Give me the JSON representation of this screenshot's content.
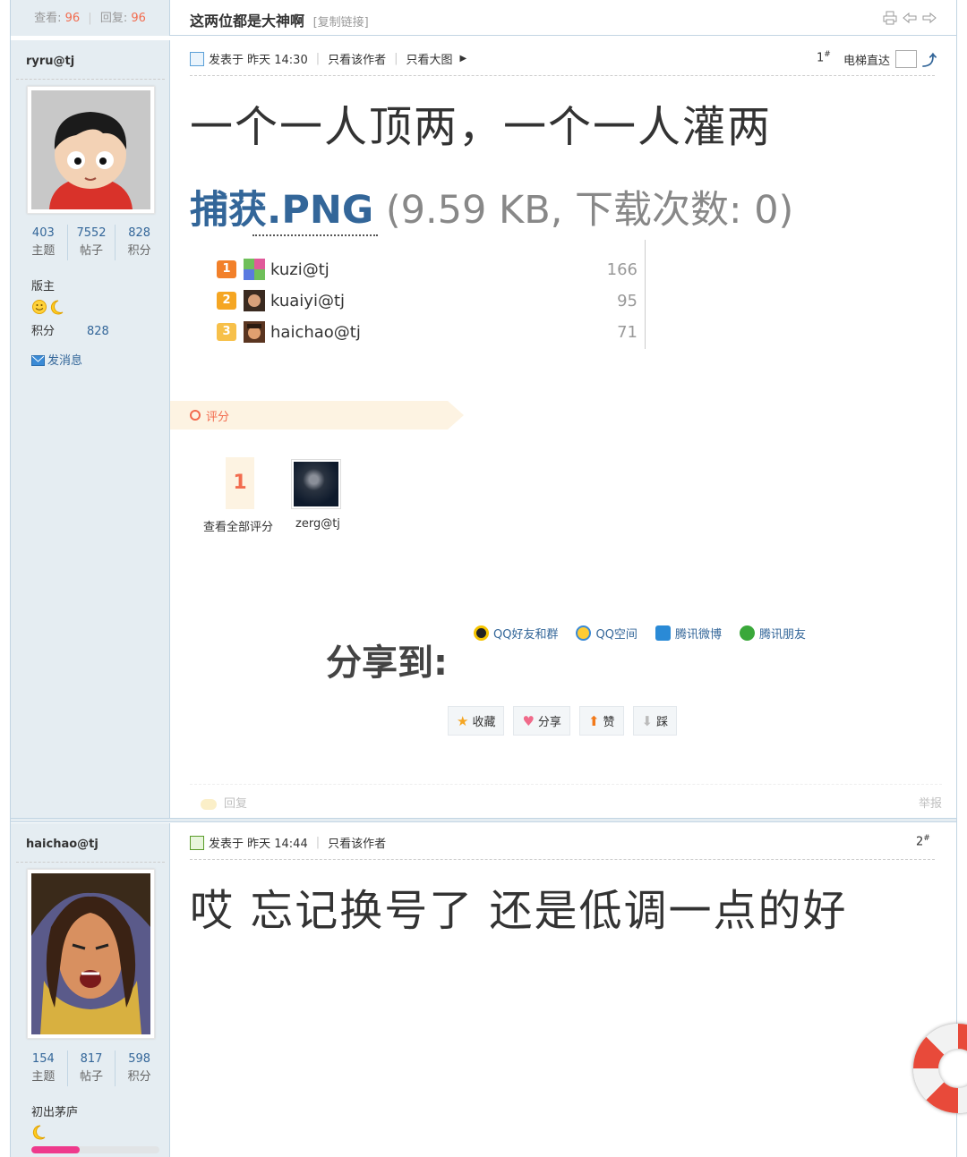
{
  "thread": {
    "views_label": "查看:",
    "views": "96",
    "replies_label": "回复:",
    "replies": "96",
    "title": "这两位都是大神啊",
    "copy_link": "[复制链接]"
  },
  "post1": {
    "author": "ryru@tj",
    "stats": [
      {
        "value": "403",
        "label": "主题"
      },
      {
        "value": "7552",
        "label": "帖子"
      },
      {
        "value": "828",
        "label": "积分"
      }
    ],
    "rank": "版主",
    "points_label": "积分",
    "points": "828",
    "send_message": "发消息",
    "posted": "发表于 昨天 14:30",
    "only_author": "只看该作者",
    "only_big_img": "只看大图",
    "floor": "1",
    "elevator": "电梯直达",
    "content": "一个一人顶两，一个一人灌两",
    "attachment_name": "捕获.PNG",
    "attachment_meta": "(9.59 KB, 下载次数: 0)",
    "ranking": [
      {
        "pos": "1",
        "name": "kuzi@tj",
        "score": "166",
        "color": "#f2802a"
      },
      {
        "pos": "2",
        "name": "kuaiyi@tj",
        "score": "95",
        "color": "#f5a623"
      },
      {
        "pos": "3",
        "name": "haichao@tj",
        "score": "71",
        "color": "#f7c04a"
      }
    ],
    "rating_label": "评分",
    "rating_count": "1",
    "rating_view_all": "查看全部评分",
    "rater": "zerg@tj",
    "share_title": "分享到:",
    "share_links": [
      "QQ好友和群",
      "QQ空间",
      "腾讯微博",
      "腾讯朋友"
    ],
    "actions": [
      "收藏",
      "分享",
      "赞",
      "踩"
    ],
    "reply": "回复",
    "report": "举报"
  },
  "post2": {
    "author": "haichao@tj",
    "stats": [
      {
        "value": "154",
        "label": "主题"
      },
      {
        "value": "817",
        "label": "帖子"
      },
      {
        "value": "598",
        "label": "积分"
      }
    ],
    "rank": "初出茅庐",
    "level_progress": 0.38,
    "posted": "发表于 昨天 14:44",
    "only_author": "只看该作者",
    "floor": "2",
    "content": "哎 忘记换号了 还是低调一点的好"
  },
  "colors": {
    "accent": "#336699",
    "highlight": "#f26c4f",
    "sidebar": "#e5edf2",
    "level_fill": "#ee3a8c"
  }
}
